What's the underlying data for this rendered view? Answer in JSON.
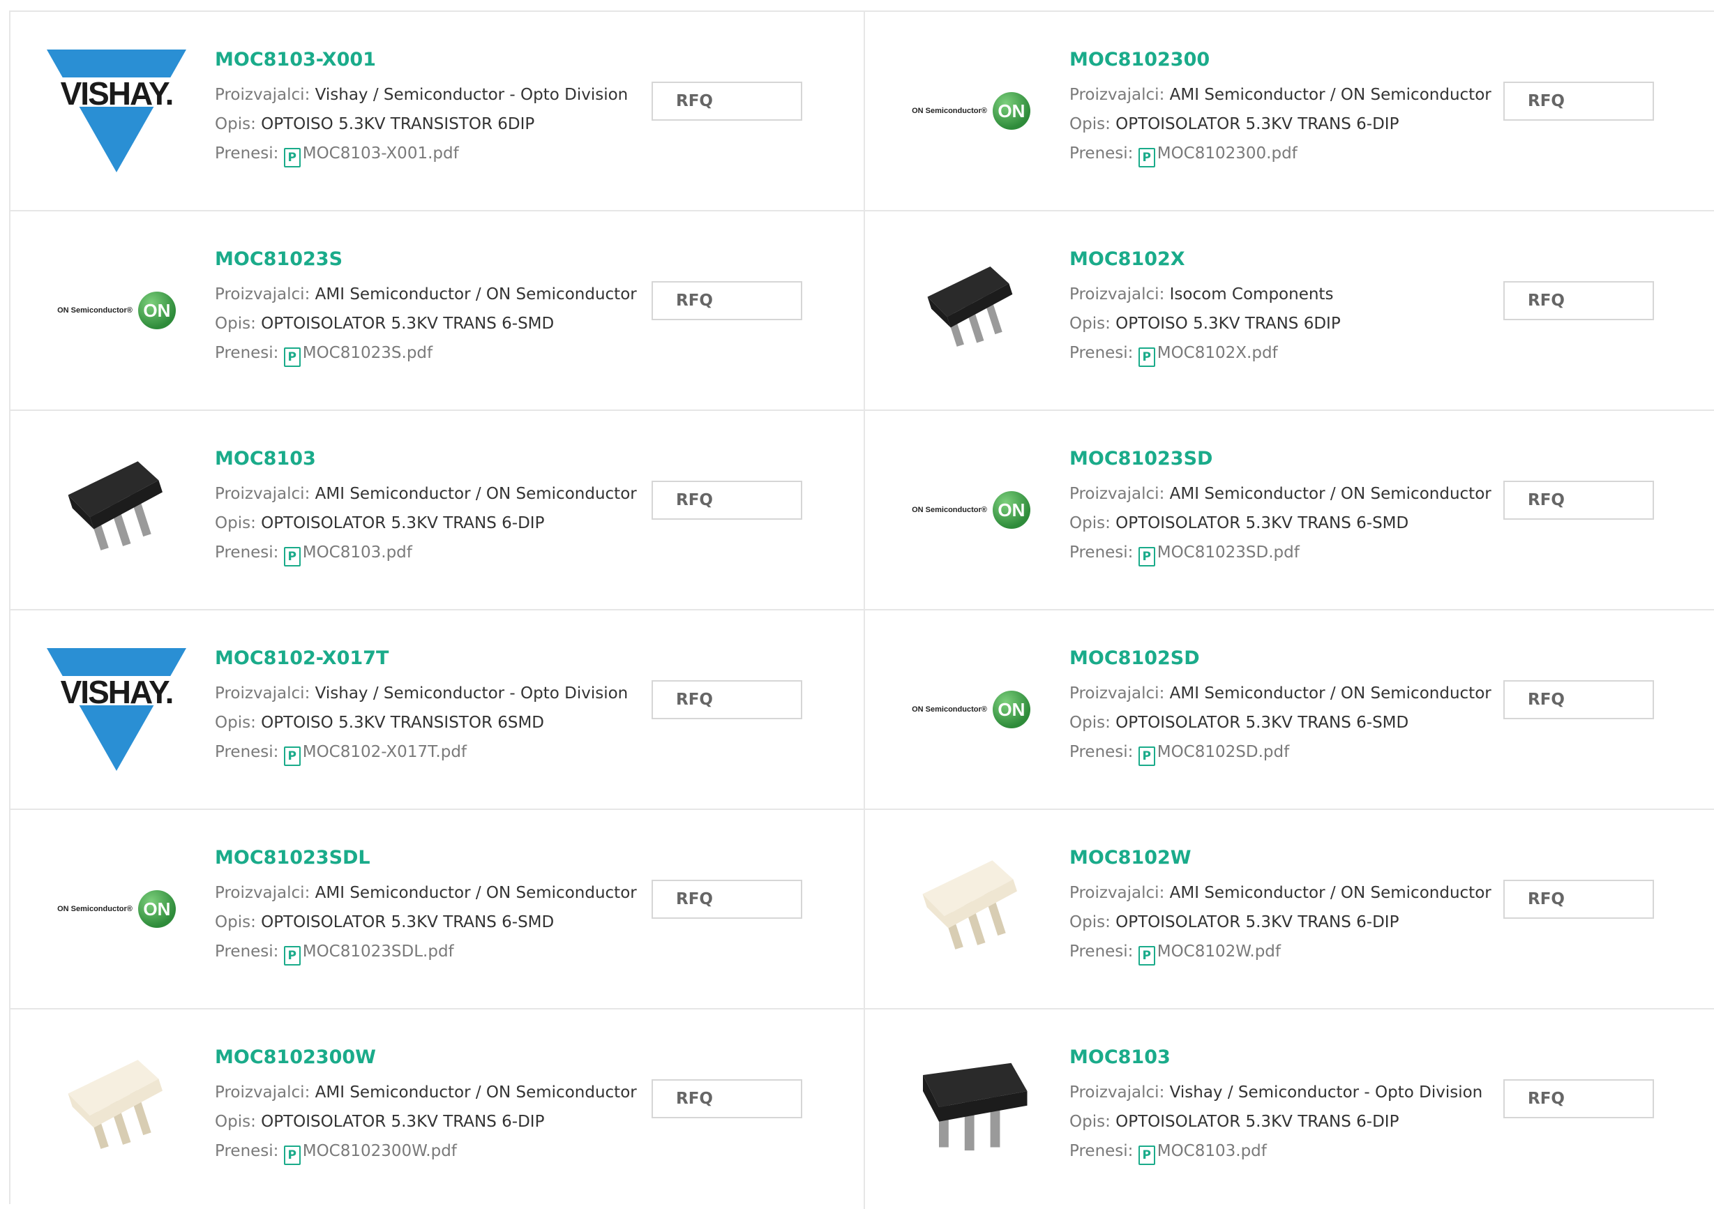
{
  "labels": {
    "manufacturer": "Proizvajalci:",
    "description": "Opis:",
    "download": "Prenesi:",
    "rfq": "RFQ",
    "pdf_icon": "P"
  },
  "colors": {
    "accent": "#1aab8a",
    "border": "#e6e6e6"
  },
  "products": [
    {
      "part": "MOC8103-X001",
      "manufacturer": "Vishay / Semiconductor - Opto Division",
      "description": "OPTOISO 5.3KV TRANSISTOR 6DIP",
      "file": "MOC8103-X001.pdf",
      "image": "vishay-logo",
      "logo_text": "VISHAY."
    },
    {
      "part": "MOC8102300",
      "manufacturer": "AMI Semiconductor / ON Semiconductor",
      "description": "OPTOISOLATOR 5.3KV TRANS 6-DIP",
      "file": "MOC8102300.pdf",
      "image": "on-semiconductor-logo",
      "logo_text": "ON Semiconductor®",
      "logo_mark": "ON"
    },
    {
      "part": "MOC81023S",
      "manufacturer": "AMI Semiconductor / ON Semiconductor",
      "description": "OPTOISOLATOR 5.3KV TRANS 6-SMD",
      "file": "MOC81023S.pdf",
      "image": "on-semiconductor-logo",
      "logo_text": "ON Semiconductor®",
      "logo_mark": "ON"
    },
    {
      "part": "MOC8102X",
      "manufacturer": "Isocom Components",
      "description": "OPTOISO 5.3KV TRANS 6DIP",
      "file": "MOC8102X.pdf",
      "image": "chip-black-small"
    },
    {
      "part": "MOC8103",
      "manufacturer": "AMI Semiconductor / ON Semiconductor",
      "description": "OPTOISOLATOR 5.3KV TRANS 6-DIP",
      "file": "MOC8103.pdf",
      "image": "chip-black"
    },
    {
      "part": "MOC81023SD",
      "manufacturer": "AMI Semiconductor / ON Semiconductor",
      "description": "OPTOISOLATOR 5.3KV TRANS 6-SMD",
      "file": "MOC81023SD.pdf",
      "image": "on-semiconductor-logo",
      "logo_text": "ON Semiconductor®",
      "logo_mark": "ON"
    },
    {
      "part": "MOC8102-X017T",
      "manufacturer": "Vishay / Semiconductor - Opto Division",
      "description": "OPTOISO 5.3KV TRANSISTOR 6SMD",
      "file": "MOC8102-X017T.pdf",
      "image": "vishay-logo",
      "logo_text": "VISHAY."
    },
    {
      "part": "MOC8102SD",
      "manufacturer": "AMI Semiconductor / ON Semiconductor",
      "description": "OPTOISOLATOR 5.3KV TRANS 6-SMD",
      "file": "MOC8102SD.pdf",
      "image": "on-semiconductor-logo",
      "logo_text": "ON Semiconductor®",
      "logo_mark": "ON"
    },
    {
      "part": "MOC81023SDL",
      "manufacturer": "AMI Semiconductor / ON Semiconductor",
      "description": "OPTOISOLATOR 5.3KV TRANS 6-SMD",
      "file": "MOC81023SDL.pdf",
      "image": "on-semiconductor-logo",
      "logo_text": "ON Semiconductor®",
      "logo_mark": "ON"
    },
    {
      "part": "MOC8102W",
      "manufacturer": "AMI Semiconductor / ON Semiconductor",
      "description": "OPTOISOLATOR 5.3KV TRANS 6-DIP",
      "file": "MOC8102W.pdf",
      "image": "chip-white"
    },
    {
      "part": "MOC8102300W",
      "manufacturer": "AMI Semiconductor / ON Semiconductor",
      "description": "OPTOISOLATOR 5.3KV TRANS 6-DIP",
      "file": "MOC8102300W.pdf",
      "image": "chip-white"
    },
    {
      "part": "MOC8103",
      "manufacturer": "Vishay / Semiconductor - Opto Division",
      "description": "OPTOISOLATOR 5.3KV TRANS 6-DIP",
      "file": "MOC8103.pdf",
      "image": "chip-black-large"
    }
  ]
}
